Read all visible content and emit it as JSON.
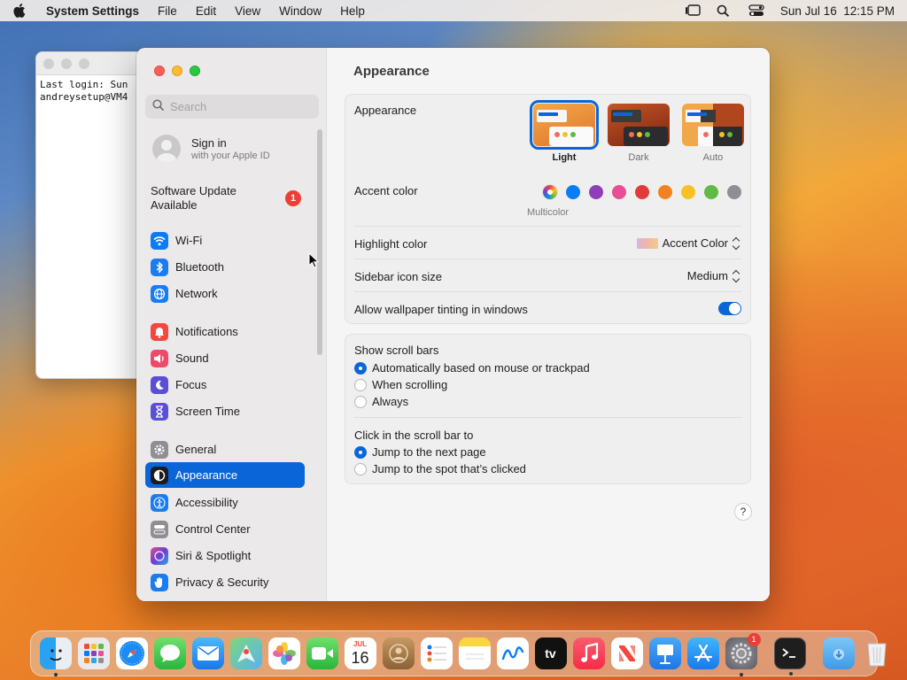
{
  "menubar": {
    "app_name": "System Settings",
    "menus": [
      "File",
      "Edit",
      "View",
      "Window",
      "Help"
    ],
    "clock": "Sun Jul 16  12:15 PM"
  },
  "terminal": {
    "lines": "Last login: Sun\nandreysetup@VM4"
  },
  "sidebar": {
    "search_placeholder": "Search",
    "signin_title": "Sign in",
    "signin_subtitle": "with your Apple ID",
    "software_update_label": "Software Update Available",
    "software_update_badge": "1",
    "items": [
      {
        "label": "Wi-Fi",
        "color": "#0a7cf5",
        "icon": "wifi-icon"
      },
      {
        "label": "Bluetooth",
        "color": "#1a7cf2",
        "icon": "bluetooth-icon"
      },
      {
        "label": "Network",
        "color": "#1a7cf2",
        "icon": "globe-icon"
      },
      {
        "label": "Notifications",
        "color": "#f4473e",
        "icon": "bell-icon"
      },
      {
        "label": "Sound",
        "color": "#f04a6b",
        "icon": "speaker-icon"
      },
      {
        "label": "Focus",
        "color": "#5a4fd6",
        "icon": "moon-icon"
      },
      {
        "label": "Screen Time",
        "color": "#5a4fd6",
        "icon": "hourglass-icon"
      },
      {
        "label": "General",
        "color": "#8e8e93",
        "icon": "gear-icon"
      },
      {
        "label": "Appearance",
        "color": "#1c1c1e",
        "icon": "appearance-icon"
      },
      {
        "label": "Accessibility",
        "color": "#1a7cf2",
        "icon": "accessibility-icon"
      },
      {
        "label": "Control Center",
        "color": "#8e8e93",
        "icon": "toggles-icon"
      },
      {
        "label": "Siri & Spotlight",
        "color": "#8b3fcf",
        "icon": "siri-icon"
      },
      {
        "label": "Privacy & Security",
        "color": "#1a7cf2",
        "icon": "hand-icon"
      }
    ],
    "selected": "Appearance"
  },
  "content": {
    "title": "Appearance",
    "appearance_label": "Appearance",
    "appearance_options": [
      "Light",
      "Dark",
      "Auto"
    ],
    "appearance_selected": "Light",
    "accent_label": "Accent color",
    "accent_selected_name": "Multicolor",
    "accent_colors": [
      "#0a7cf5",
      "#8e3fb8",
      "#e84d95",
      "#e03a3a",
      "#f2821e",
      "#f6c223",
      "#5fba46",
      "#8e8e93"
    ],
    "highlight_label": "Highlight color",
    "highlight_value": "Accent Color",
    "sidebar_icon_label": "Sidebar icon size",
    "sidebar_icon_value": "Medium",
    "wallpaper_tint_label": "Allow wallpaper tinting in windows",
    "wallpaper_tint_on": true,
    "scroll_bars_label": "Show scroll bars",
    "scroll_bars_options": [
      "Automatically based on mouse or trackpad",
      "When scrolling",
      "Always"
    ],
    "click_scroll_label": "Click in the scroll bar to",
    "click_scroll_options": [
      "Jump to the next page",
      "Jump to the spot that’s clicked"
    ],
    "help": "?"
  },
  "dock": {
    "calendar_month": "JUL",
    "calendar_day": "16",
    "appletv_label": "tv",
    "settings_badge": "1"
  }
}
